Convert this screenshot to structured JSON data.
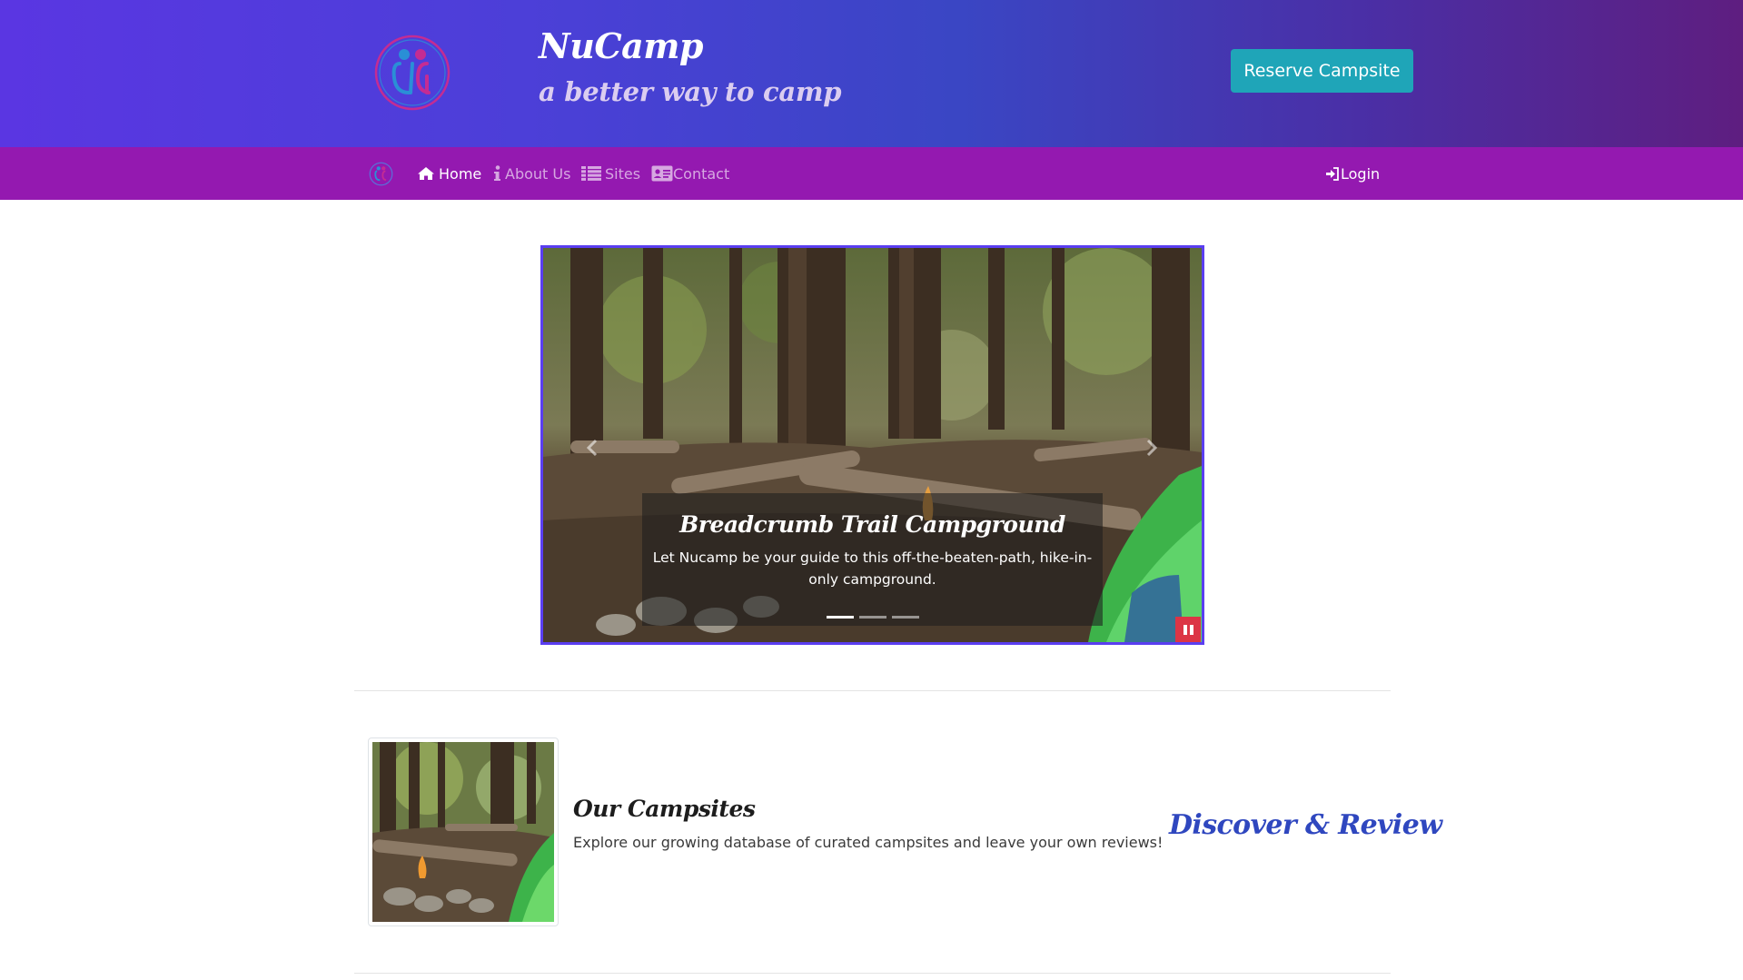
{
  "header": {
    "brand_title": "NuCamp",
    "brand_subtitle": "a better way to camp",
    "reserve_label": "Reserve Campsite"
  },
  "navbar": {
    "items": [
      {
        "label": "Home",
        "icon": "home-icon",
        "active": true
      },
      {
        "label": "About Us",
        "icon": "info-icon",
        "active": false
      },
      {
        "label": "Sites",
        "icon": "list-icon",
        "active": false
      },
      {
        "label": "Contact",
        "icon": "address-card-icon",
        "active": false
      }
    ],
    "login_label": "Login",
    "login_icon": "sign-in-icon"
  },
  "carousel": {
    "caption_title": "Breadcrumb Trail Campground",
    "caption_text": "Let Nucamp be your guide to this off-the-beaten-path, hike-in-only campground.",
    "indicator_count": 3,
    "active_index": 0
  },
  "feature": {
    "title": "Our Campsites",
    "text": "Explore our growing database of curated campsites and leave your own reviews!",
    "tagline": "Discover & Review"
  },
  "colors": {
    "header_gradient_start": "#5a36e2",
    "header_gradient_end": "#5e1e80",
    "navbar": "#9419b0",
    "reserve_button": "#1fa5b8",
    "carousel_border": "#5a3ef0",
    "pause_button": "#dc3545",
    "tagline": "#2f47bf"
  }
}
